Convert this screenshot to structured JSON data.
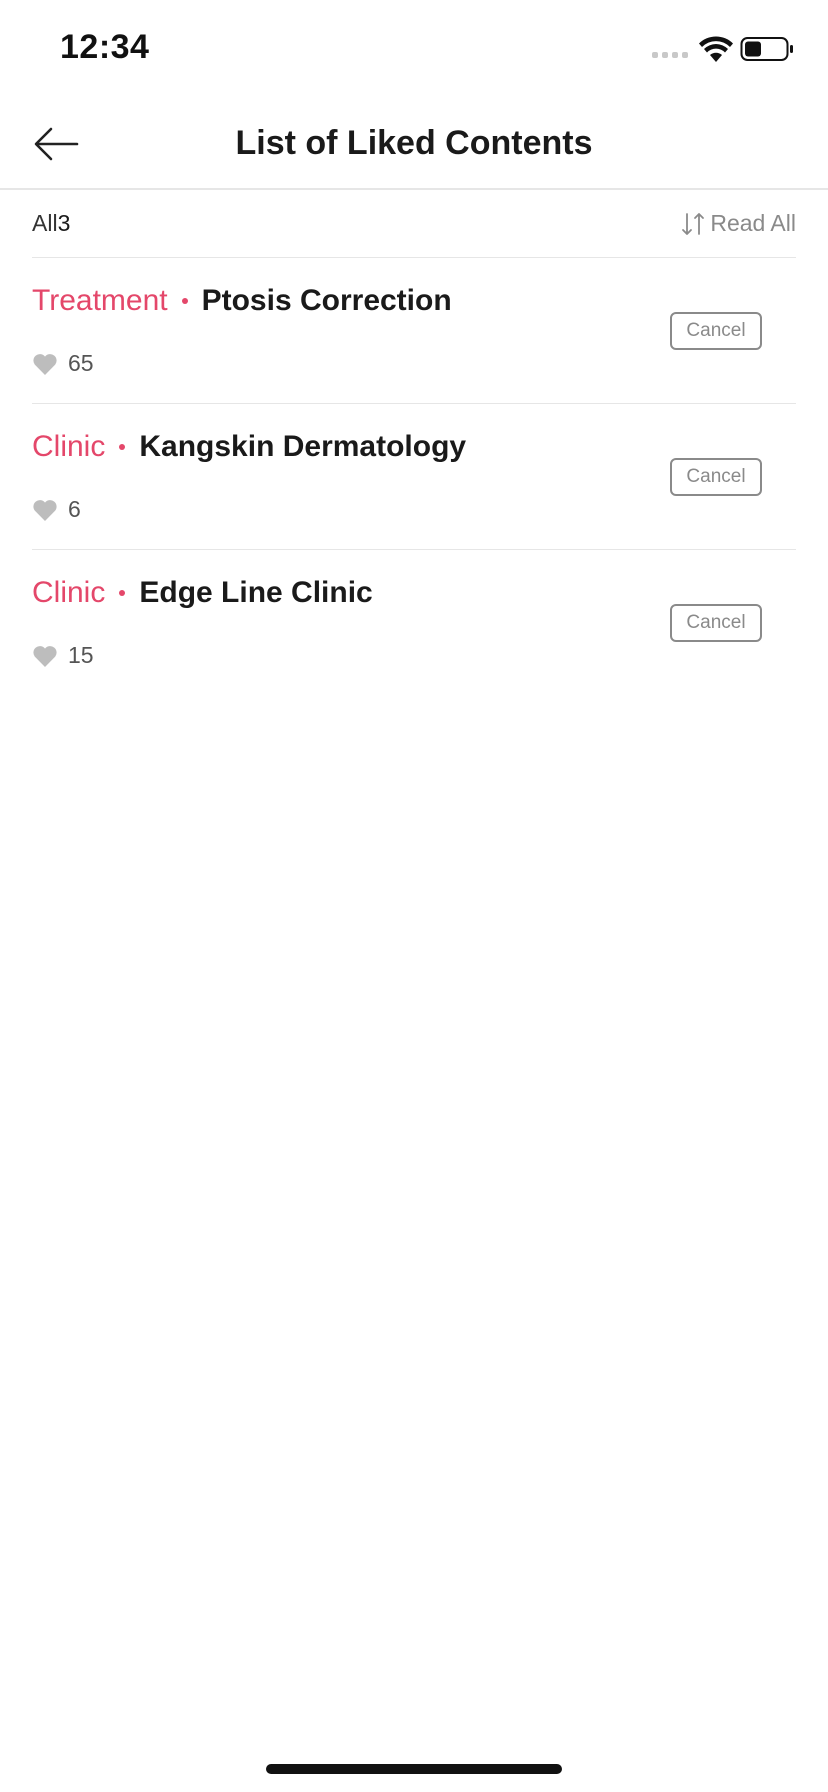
{
  "status_bar": {
    "time": "12:34"
  },
  "header": {
    "title": "List of Liked Contents",
    "back_icon": "arrow-left-icon"
  },
  "filter": {
    "all_label": "All",
    "all_count": "3",
    "sort_label": "Read All",
    "sort_icon": "sort-arrows-icon"
  },
  "items": [
    {
      "category": "Treatment",
      "name": "Ptosis Correction",
      "likes": "65",
      "cancel_label": "Cancel"
    },
    {
      "category": "Clinic",
      "name": "Kangskin Dermatology",
      "likes": "6",
      "cancel_label": "Cancel"
    },
    {
      "category": "Clinic",
      "name": "Edge Line Clinic",
      "likes": "15",
      "cancel_label": "Cancel"
    }
  ],
  "colors": {
    "accent": "#e4476a",
    "muted": "#8a8a8a",
    "divider": "#e6e6e6",
    "heart": "#bdbdbd"
  }
}
